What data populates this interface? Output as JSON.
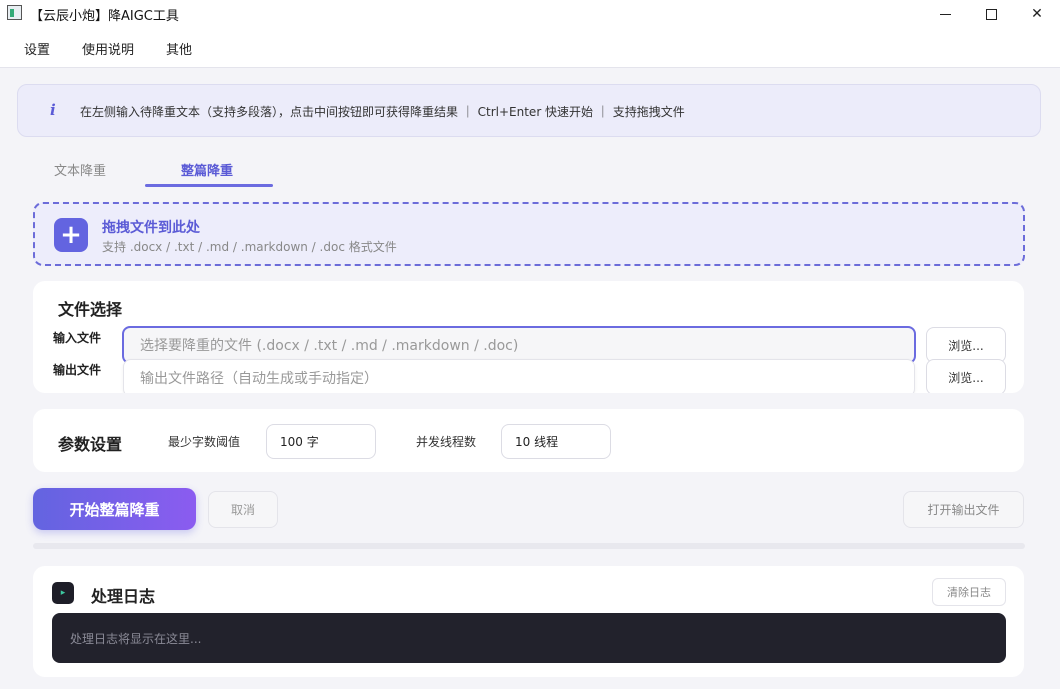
{
  "window": {
    "title": "【云辰小炮】降AIGC工具",
    "minimize": "minimize",
    "maximize": "maximize",
    "close": "✕"
  },
  "menu": [
    "设置",
    "使用说明",
    "其他"
  ],
  "info_banner": {
    "icon": "i",
    "text": "在左侧输入待降重文本（支持多段落），点击中间按钮即可获得降重结果 ｜ Ctrl+Enter 快速开始 ｜ 支持拖拽文件"
  },
  "tabs": [
    {
      "label": "文本降重",
      "active": false
    },
    {
      "label": "整篇降重",
      "active": true
    }
  ],
  "dropzone": {
    "icon": "+",
    "title": "拖拽文件到此处",
    "subtitle": "支持 .docx / .txt / .md / .markdown / .doc 格式文件"
  },
  "file_select": {
    "title": "文件选择",
    "input_label": "输入文件",
    "input_placeholder": "选择要降重的文件 (.docx / .txt / .md / .markdown / .doc)",
    "output_label": "输出文件",
    "output_placeholder": "输出文件路径（自动生成或手动指定）",
    "browse_label": "浏览..."
  },
  "params": {
    "title": "参数设置",
    "min_chars_label": "最少字数阈值",
    "min_chars_value": "100 字",
    "threads_label": "并发线程数",
    "threads_value": "10 线程"
  },
  "actions": {
    "start": "开始整篇降重",
    "cancel": "取消",
    "open_output": "打开输出文件"
  },
  "progress": {
    "value": 0
  },
  "log": {
    "icon": "▸",
    "title": "处理日志",
    "clear": "清除日志",
    "placeholder": "处理日志将显示在这里..."
  },
  "colors": {
    "accent": "#6364e0",
    "accent_gradient_end": "#8b5cf0",
    "log_bg": "#22222c"
  }
}
